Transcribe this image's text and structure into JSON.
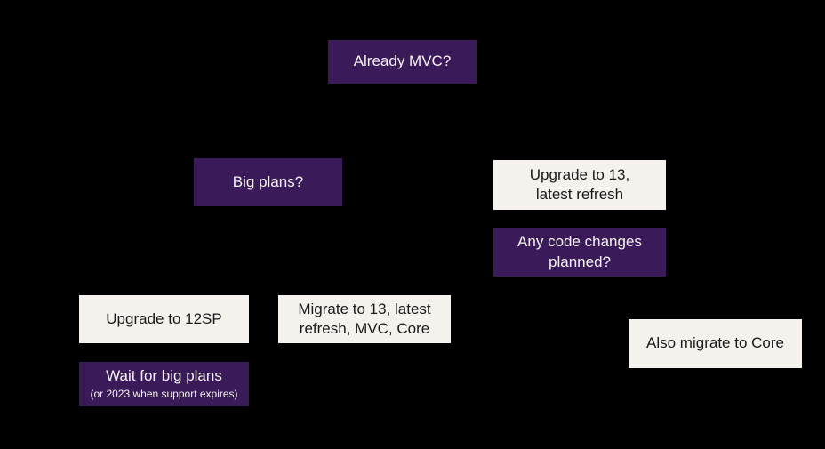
{
  "nodes": {
    "root": {
      "label": "Already MVC?"
    },
    "bigPlans": {
      "label": "Big plans?"
    },
    "upgrade13": {
      "label": "Upgrade to 13, latest refresh"
    },
    "codeChanges": {
      "label": "Any code changes planned?"
    },
    "upgrade12sp": {
      "label": "Upgrade to 12SP"
    },
    "migrate13": {
      "label": "Migrate to 13, latest refresh, MVC, Core"
    },
    "waitBigPlans": {
      "label": "Wait for big plans",
      "sub": "(or 2023 when support expires)"
    },
    "migrateCore": {
      "label": "Also migrate to Core"
    }
  }
}
